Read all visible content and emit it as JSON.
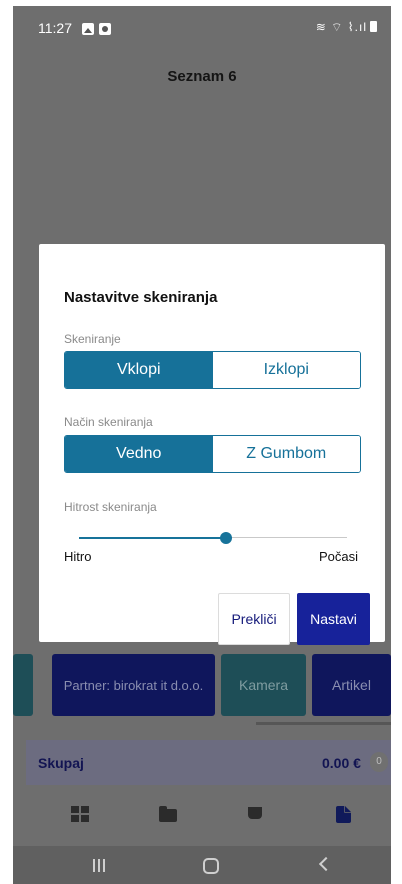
{
  "status_bar": {
    "time": "11:27",
    "right_icons": "≋ ⌔ ⌇.ıl"
  },
  "header": {
    "title": "Seznam 6"
  },
  "dialog": {
    "title": "Nastavitve skeniranja",
    "scanning": {
      "label": "Skeniranje",
      "options": [
        "Vklopi",
        "Izklopi"
      ],
      "selected": "Vklopi"
    },
    "scan_mode": {
      "label": "Način skeniranja",
      "options": [
        "Vedno",
        "Z Gumbom"
      ],
      "selected": "Vedno"
    },
    "scan_speed": {
      "label": "Hitrost skeniranja",
      "min_label": "Hitro",
      "max_label": "Počasi",
      "value_fraction": 0.55
    },
    "cancel_label": "Prekliči",
    "continue_label": "Nastavi"
  },
  "action_buttons": {
    "partner": "Partner: birokrat it d.o.o.",
    "camera": "Kamera",
    "article": "Artikel"
  },
  "total": {
    "label": "Skupaj",
    "value": "0.00 €",
    "count": "0"
  },
  "tabs": [
    "grid-icon",
    "folder-icon",
    "cup-icon",
    "document-icon"
  ],
  "colors": {
    "accent": "#167199",
    "primary": "#17229a",
    "overlay": "#6e6e6e"
  }
}
